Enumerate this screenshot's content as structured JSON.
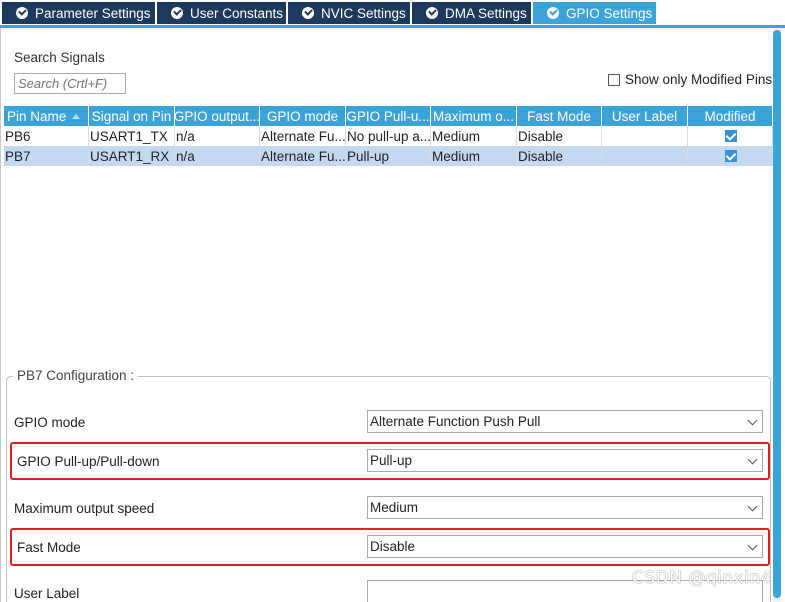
{
  "tabs": [
    {
      "label": "Parameter Settings",
      "active": false
    },
    {
      "label": "User Constants",
      "active": false
    },
    {
      "label": "NVIC Settings",
      "active": false
    },
    {
      "label": "DMA Settings",
      "active": false
    },
    {
      "label": "GPIO Settings",
      "active": true
    }
  ],
  "search": {
    "label": "Search Signals",
    "placeholder": "Search (Crtl+F)"
  },
  "show_modified": {
    "label": "Show only Modified Pins",
    "checked": false
  },
  "table": {
    "headers": [
      "Pin Name",
      "Signal on Pin",
      "GPIO output...",
      "GPIO mode",
      "GPIO Pull-u...",
      "Maximum o...",
      "Fast Mode",
      "User Label",
      "Modified"
    ],
    "rows": [
      {
        "pin": "PB6",
        "signal": "USART1_TX",
        "output": "n/a",
        "mode": "Alternate Fu...",
        "pull": "No pull-up a...",
        "speed": "Medium",
        "fast": "Disable",
        "label": "",
        "modified": true,
        "selected": false
      },
      {
        "pin": "PB7",
        "signal": "USART1_RX",
        "output": "n/a",
        "mode": "Alternate Fu...",
        "pull": "Pull-up",
        "speed": "Medium",
        "fast": "Disable",
        "label": "",
        "modified": true,
        "selected": true
      }
    ]
  },
  "config": {
    "title": "PB7 Configuration :",
    "fields": [
      {
        "label": "GPIO mode",
        "value": "Alternate Function Push Pull",
        "highlighted": false
      },
      {
        "label": "GPIO Pull-up/Pull-down",
        "value": "Pull-up",
        "highlighted": true
      },
      {
        "label": "Maximum output speed",
        "value": "Medium",
        "highlighted": false
      },
      {
        "label": "Fast Mode",
        "value": "Disable",
        "highlighted": true
      },
      {
        "label": "User Label",
        "value": "",
        "highlighted": false
      }
    ]
  },
  "watermark": "CSDN @qinxin4",
  "colors": {
    "tab_bg": "#1d3a5c",
    "accent": "#3aa3d8",
    "selected_row": "#c3d9f0",
    "highlight": "#e02020"
  }
}
